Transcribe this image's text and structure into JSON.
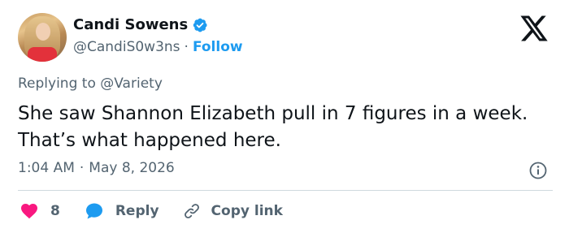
{
  "author": {
    "name": "Candi Sowens",
    "handle": "@CandiS0w3ns",
    "separator": "·",
    "follow_label": "Follow",
    "verified_icon": "verified-badge-icon",
    "avatar": "avatar"
  },
  "logo": {
    "icon": "x-logo-icon"
  },
  "reply_context": {
    "prefix": "Replying to",
    "mention": "@Variety"
  },
  "tweet": {
    "text": "She saw Shannon Elizabeth pull in 7 figures in a week. That’s what happened here.",
    "time": "1:04 AM",
    "separator": "·",
    "date": "May 8, 2026",
    "info_icon": "info-icon"
  },
  "actions": {
    "like": {
      "icon": "heart-icon",
      "count": "8"
    },
    "reply": {
      "icon": "speech-bubble-icon",
      "label": "Reply"
    },
    "copy": {
      "icon": "link-icon",
      "label": "Copy link"
    }
  },
  "colors": {
    "accent": "#1d9bf0",
    "heart": "#f91880",
    "text": "#0f1419",
    "muted": "#536471",
    "divider": "#cfd9de"
  }
}
